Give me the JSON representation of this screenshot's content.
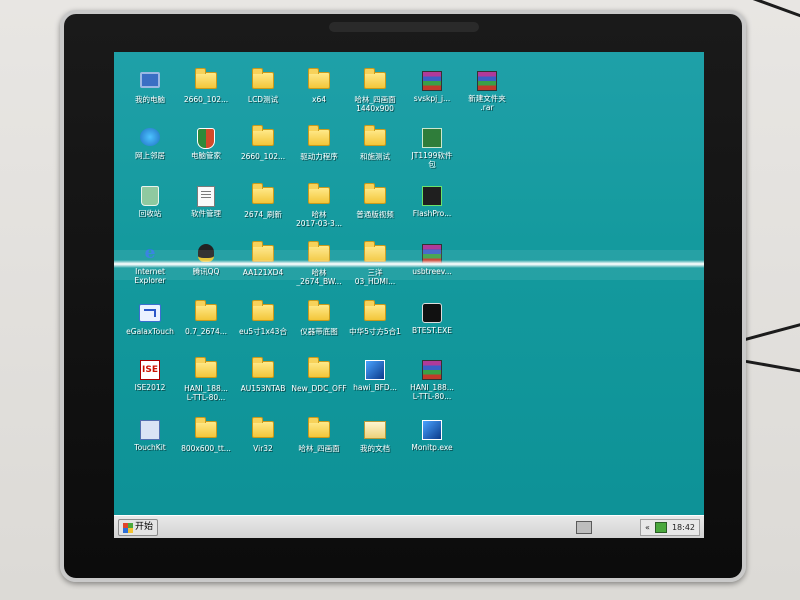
{
  "desktop": {
    "icons": [
      {
        "label": "我的电脑",
        "icon": "computer-icon"
      },
      {
        "label": "2660_102...",
        "icon": "folder-icon"
      },
      {
        "label": "LCD测试",
        "icon": "folder-icon"
      },
      {
        "label": "x64",
        "icon": "folder-icon"
      },
      {
        "label": "哈林_四画面",
        "label2": "1440x900",
        "icon": "folder-icon"
      },
      {
        "label": "svskpj_j...",
        "icon": "winrar-icon"
      },
      {
        "label": "新建文件夹",
        "label2": ".rar",
        "icon": "winrar-icon"
      },
      {
        "label": "网上邻居",
        "icon": "network-icon"
      },
      {
        "label": "电脑管家",
        "icon": "shield-icon"
      },
      {
        "label": "2660_102...",
        "icon": "folder-icon"
      },
      {
        "label": "驱动力程序",
        "icon": "folder-icon"
      },
      {
        "label": "和施测试",
        "icon": "folder-icon"
      },
      {
        "label": "JT1199软件",
        "label2": "包",
        "icon": "board-icon"
      },
      {
        "label": "回收站",
        "icon": "recycle-bin-icon"
      },
      {
        "label": "软件管理",
        "icon": "document-icon"
      },
      {
        "label": "2674_刷新",
        "icon": "folder-icon"
      },
      {
        "label": "哈林",
        "label2": "2017-03-3...",
        "icon": "folder-icon"
      },
      {
        "label": "普通版视频",
        "icon": "folder-icon"
      },
      {
        "label": "FlashPro...",
        "icon": "flash-icon"
      },
      {
        "label": "Internet",
        "label2": "Explorer",
        "icon": "internet-explorer-icon"
      },
      {
        "label": "腾讯QQ",
        "icon": "qq-icon"
      },
      {
        "label": "AA121XD4",
        "icon": "folder-icon"
      },
      {
        "label": "哈林",
        "label2": "_2674_BW...",
        "icon": "folder-icon"
      },
      {
        "label": "三洋",
        "label2": "03_HDMI...",
        "icon": "folder-icon"
      },
      {
        "label": "usbtreev...",
        "icon": "winrar-icon"
      },
      {
        "label": "eGalaxTouch",
        "icon": "egalax-icon"
      },
      {
        "label": "0.7_2674...",
        "icon": "folder-icon"
      },
      {
        "label": "eu5寸1x43合",
        "icon": "folder-icon"
      },
      {
        "label": "仪器带底图",
        "icon": "folder-icon"
      },
      {
        "label": "中华5寸方5合1",
        "icon": "folder-icon"
      },
      {
        "label": "BTEST.EXE",
        "icon": "speaker-icon"
      },
      {
        "label": "ISE2012",
        "icon": "ise-icon"
      },
      {
        "label": "HANI_188...",
        "label2": "L-TTL-80...",
        "icon": "folder-icon"
      },
      {
        "label": "AU153NTAB",
        "icon": "folder-icon"
      },
      {
        "label": "New_DDC_OFF",
        "icon": "folder-icon"
      },
      {
        "label": "hawi_BFD...",
        "icon": "blue-app-icon"
      },
      {
        "label": "HANI_188...",
        "label2": "L-TTL-80...",
        "icon": "winrar-icon"
      },
      {
        "label": "TouchKit",
        "icon": "touchkit-icon"
      },
      {
        "label": "800x600_tt...",
        "icon": "folder-icon"
      },
      {
        "label": "Vir32",
        "icon": "folder-icon"
      },
      {
        "label": "哈林_四画面",
        "icon": "folder-icon"
      },
      {
        "label": "我的文档",
        "icon": "my-documents-icon"
      },
      {
        "label": "Monitp.exe",
        "icon": "blue-app-icon"
      }
    ]
  },
  "taskbar": {
    "start_label": "开始",
    "clock": "18:42",
    "tray_chevron": "«"
  }
}
